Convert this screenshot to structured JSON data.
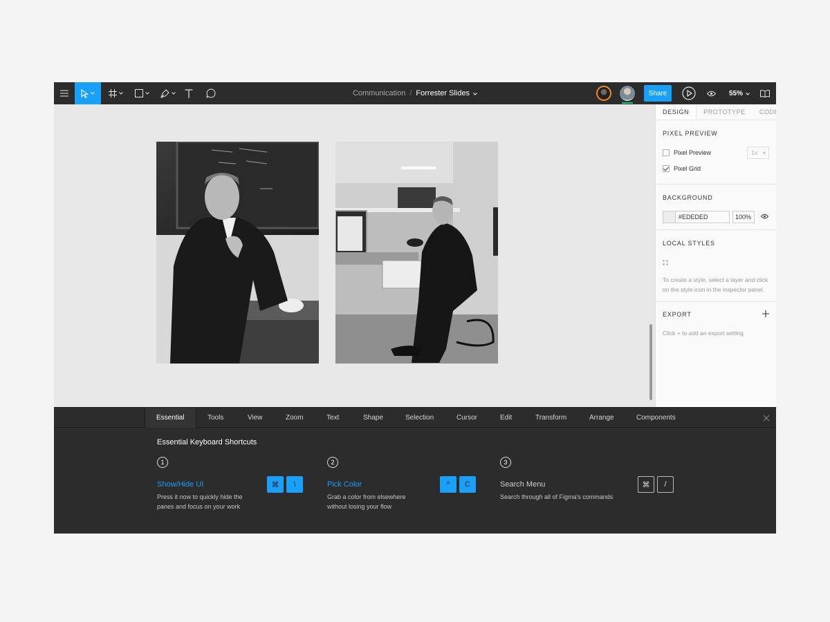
{
  "toolbar": {
    "project": "Communication",
    "separator": "/",
    "file": "Forrester Slides",
    "share_label": "Share",
    "zoom_level": "55%"
  },
  "panel": {
    "tabs": [
      "DESIGN",
      "PROTOTYPE",
      "CODE"
    ],
    "pixel_preview": {
      "title": "PIXEL PREVIEW",
      "preview_label": "Pixel Preview",
      "preview_scale": "1x",
      "grid_label": "Pixel Grid"
    },
    "background": {
      "title": "BACKGROUND",
      "hex": "#EDEDED",
      "opacity": "100%"
    },
    "local_styles": {
      "title": "LOCAL STYLES",
      "hint": "To create a style, select a layer and click on the style icon in the inspector panel."
    },
    "export": {
      "title": "EXPORT",
      "hint": "Click + to add an export setting"
    }
  },
  "shortcuts": {
    "tabs": [
      "Essential",
      "Tools",
      "View",
      "Zoom",
      "Text",
      "Shape",
      "Selection",
      "Cursor",
      "Edit",
      "Transform",
      "Arrange",
      "Components"
    ],
    "heading": "Essential Keyboard Shortcuts",
    "items": [
      {
        "number": "1",
        "title": "Show/Hide UI",
        "desc": "Press it now to quickly hide the panes and focus on your work",
        "keys": [
          "⌘",
          "\\"
        ]
      },
      {
        "number": "2",
        "title": "Pick Color",
        "desc": "Grab a color from elsewhere without losing your flow",
        "keys": [
          "^",
          "C"
        ]
      },
      {
        "number": "3",
        "title": "Search Menu",
        "desc": "Search through all of Figma's commands",
        "keys": [
          "⌘",
          "/"
        ]
      }
    ]
  },
  "colors": {
    "accent": "#18a0fb",
    "toolbar_bg": "#2c2c2c",
    "canvas_bg": "#e8e8e8"
  }
}
